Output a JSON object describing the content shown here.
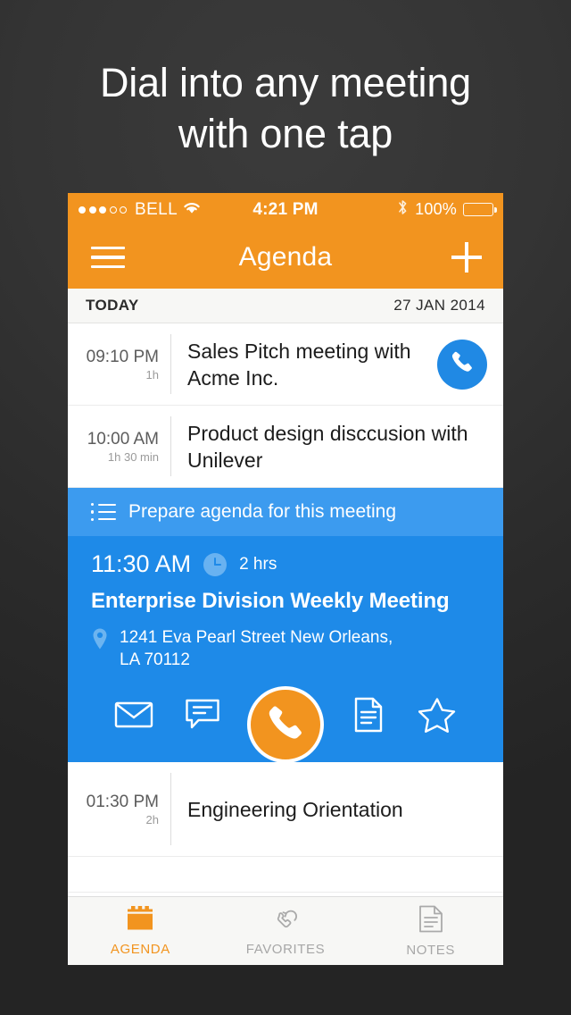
{
  "promo": {
    "headline": "Dial into any meeting\nwith one tap"
  },
  "colors": {
    "orange": "#F2941F",
    "blue": "#1E8AE8",
    "blue_banner": "#3C9BEF",
    "blue_call": "#2089E4",
    "backdrop": "#2a2a2a"
  },
  "status_bar": {
    "carrier": "BELL",
    "signal_dots_filled": 3,
    "signal_dots_total": 5,
    "wifi_icon": "wifi-icon",
    "time": "4:21 PM",
    "bluetooth_icon": "bluetooth-icon",
    "battery_percent": "100%",
    "battery_icon": "battery-full-icon"
  },
  "nav_bar": {
    "menu_icon": "hamburger-menu-icon",
    "title": "Agenda",
    "add_icon": "plus-icon"
  },
  "day_header": {
    "label": "TODAY",
    "date": "27 JAN 2014"
  },
  "events": [
    {
      "time": "09:10 PM",
      "duration": "1h",
      "title": "Sales Pitch meeting with Acme Inc.",
      "call_icon": "phone-icon",
      "has_call_button": true
    },
    {
      "time": "10:00 AM",
      "duration": "1h 30 min",
      "title": "Product design disccusion with Unilever",
      "has_call_button": false
    }
  ],
  "expanded_event": {
    "banner": {
      "icon": "bulleted-list-icon",
      "text": "Prepare agenda for this meeting"
    },
    "time": "11:30 AM",
    "clock_icon": "clock-icon",
    "duration": "2 hrs",
    "title": "Enterprise Division Weekly Meeting",
    "location_icon": "map-pin-icon",
    "address": "1241 Eva Pearl Street New Orleans,\nLA 70112",
    "actions": [
      {
        "name": "email-action",
        "icon": "envelope-icon"
      },
      {
        "name": "message-action",
        "icon": "chat-bubble-icon"
      },
      {
        "name": "call-action",
        "icon": "phone-icon",
        "primary": true
      },
      {
        "name": "notes-action",
        "icon": "document-icon"
      },
      {
        "name": "favorite-action",
        "icon": "star-icon"
      }
    ]
  },
  "events_after": [
    {
      "time": "01:30 PM",
      "duration": "2h",
      "title": "Engineering Orientation"
    }
  ],
  "tab_bar": {
    "tabs": [
      {
        "label": "AGENDA",
        "icon": "calendar-icon",
        "active": true
      },
      {
        "label": "FAVORITES",
        "icon": "phone-arrow-icon",
        "active": false
      },
      {
        "label": "NOTES",
        "icon": "document-lines-icon",
        "active": false
      }
    ]
  }
}
